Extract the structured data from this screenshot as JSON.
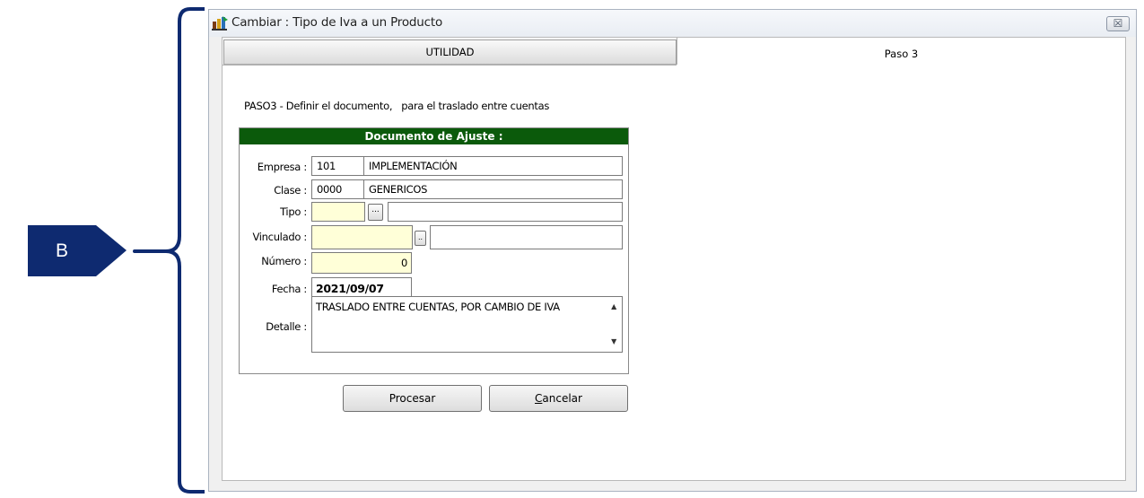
{
  "annotation": {
    "label": "B"
  },
  "window": {
    "title": "Cambiar : Tipo de Iva a un Producto",
    "close_glyph": "☒"
  },
  "tabs": [
    {
      "label": "UTILIDAD"
    },
    {
      "label": "Paso 3"
    }
  ],
  "instruction": "PASO3 - Definir el documento,   para el traslado entre cuentas",
  "panel": {
    "header": "Documento de Ajuste :",
    "fields": {
      "empresa": {
        "label": "Empresa :",
        "code": "101",
        "name": "IMPLEMENTACIÓN"
      },
      "clase": {
        "label": "Clase :",
        "code": "0000",
        "name": "GENERICOS"
      },
      "tipo": {
        "label": "Tipo :",
        "code": "",
        "button": "...",
        "name": ""
      },
      "vinculado": {
        "label": "Vinculado :",
        "code": "",
        "button": "..",
        "name": ""
      },
      "numero": {
        "label": "Número :",
        "value": "0"
      },
      "fecha": {
        "label": "Fecha :",
        "value": "2021/09/07"
      },
      "detalle": {
        "label": "Detalle :",
        "value": "TRASLADO ENTRE CUENTAS, POR CAMBIO DE IVA"
      }
    }
  },
  "buttons": {
    "procesar": "Procesar",
    "cancelar": "Cancelar"
  },
  "colors": {
    "annotation": "#0e2a70",
    "panel_header": "#0b5a0b",
    "input_highlight": "#ffffd8"
  }
}
